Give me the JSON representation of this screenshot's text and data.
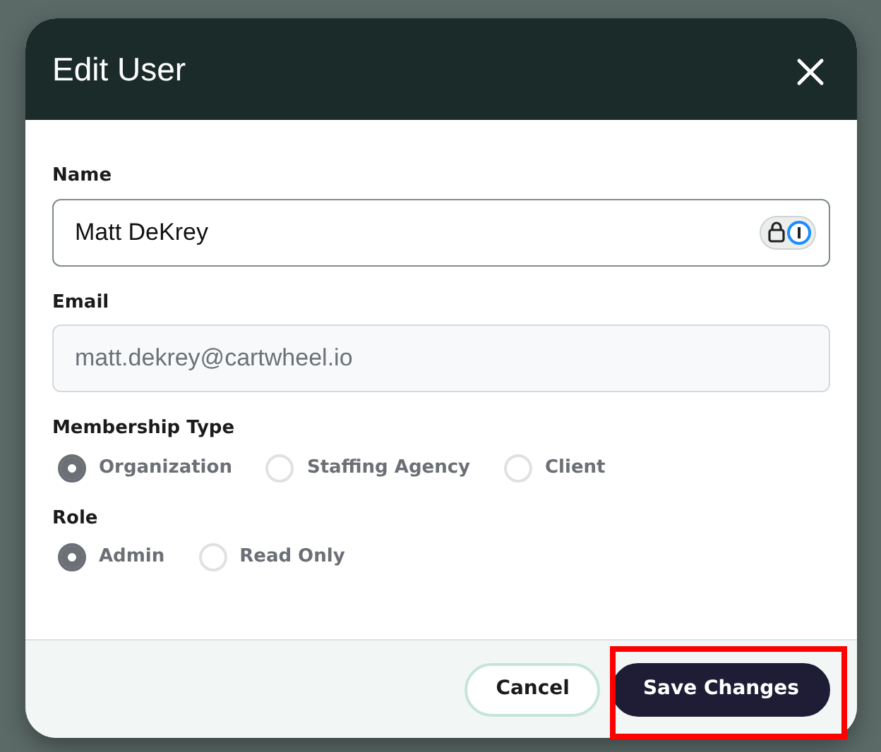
{
  "dialog": {
    "title": "Edit User",
    "fields": [
      {
        "label": "Name",
        "value": "Matt DeKrey",
        "disabled": false,
        "focused": true
      },
      {
        "label": "Email",
        "value": "matt.dekrey@cartwheel.io",
        "disabled": true,
        "focused": false
      }
    ],
    "radio_groups": [
      {
        "label": "Membership Type",
        "options": [
          {
            "label": "Organization",
            "selected": true
          },
          {
            "label": "Staffing Agency",
            "selected": false
          },
          {
            "label": "Client",
            "selected": false
          }
        ]
      },
      {
        "label": "Role",
        "options": [
          {
            "label": "Admin",
            "selected": true
          },
          {
            "label": "Read Only",
            "selected": false
          }
        ]
      }
    ],
    "buttons": [
      {
        "label": "Cancel",
        "kind": "secondary"
      },
      {
        "label": "Save Changes",
        "kind": "primary",
        "highlighted": true
      }
    ]
  }
}
